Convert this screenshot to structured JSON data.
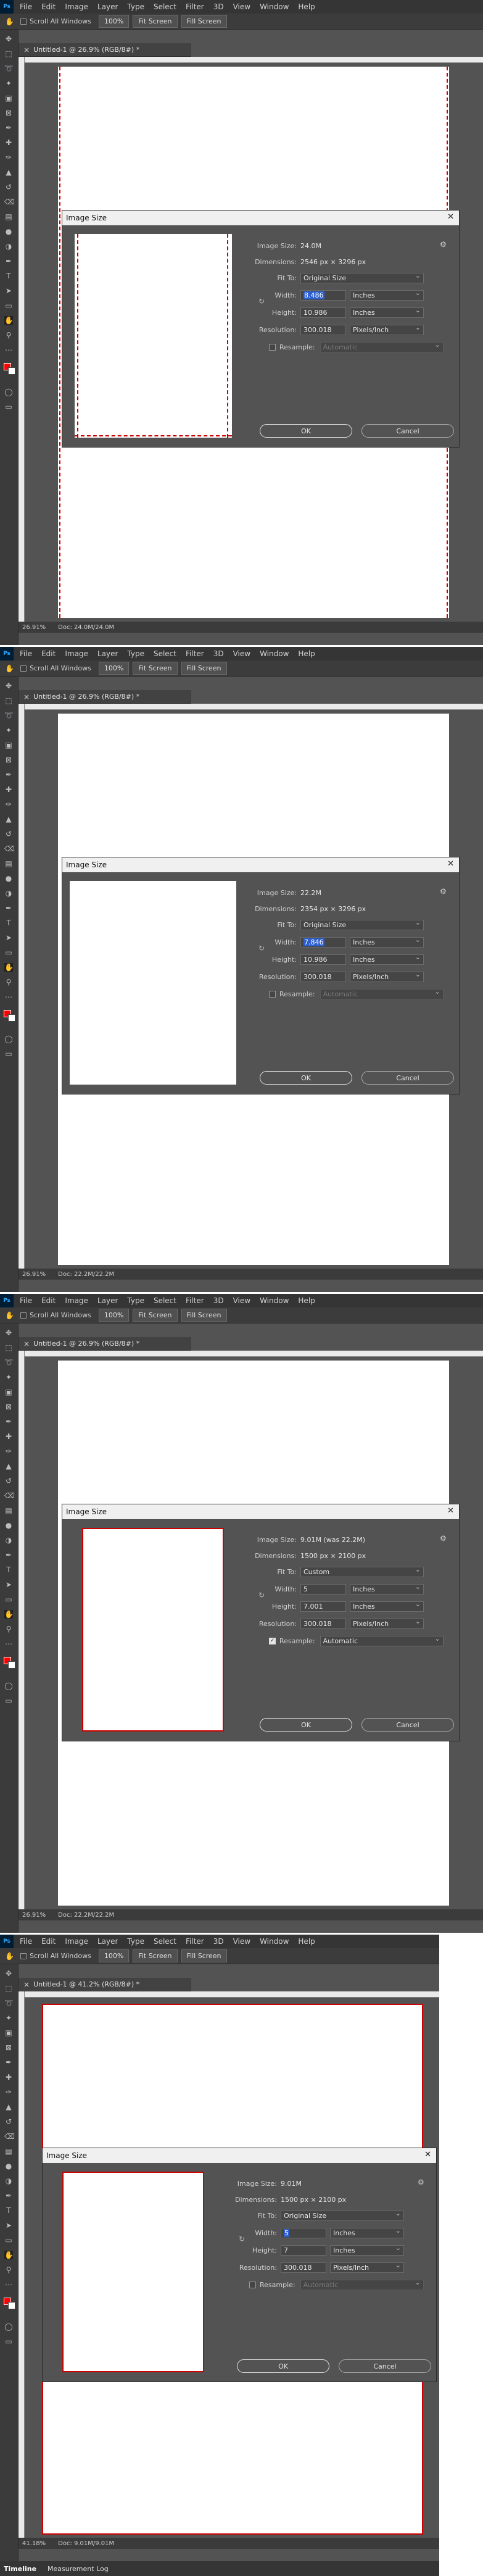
{
  "menu": {
    "logo": "Ps",
    "items": [
      "File",
      "Edit",
      "Image",
      "Layer",
      "Type",
      "Select",
      "Filter",
      "3D",
      "View",
      "Window",
      "Help"
    ]
  },
  "options": {
    "scroll_all_windows": "Scroll All Windows",
    "zoom_label": "100%",
    "fit_screen": "Fit Screen",
    "fill_screen": "Fill Screen"
  },
  "dialog_common": {
    "title": "Image Size",
    "image_size_label": "Image Size:",
    "dimensions_label": "Dimensions:",
    "fit_to_label": "Fit To:",
    "width_label": "Width:",
    "height_label": "Height:",
    "resolution_label": "Resolution:",
    "resample_label": "Resample:",
    "ok": "OK",
    "cancel": "Cancel",
    "units_inches": "Inches",
    "units_ppi": "Pixels/Inch"
  },
  "shots": [
    {
      "doc_tab": "Untitled-1 @ 26.9% (RGB/8#) *",
      "image_size": "24.0M",
      "dimensions": "2546 px  ×  3296 px",
      "fit_to": "Original Size",
      "width": "8.486",
      "height": "10.986",
      "resolution": "300.018",
      "resample_checked": false,
      "resample_value": "Automatic",
      "status_zoom": "26.91%",
      "status_doc": "Doc: 24.0M/24.0M"
    },
    {
      "doc_tab": "Untitled-1 @ 26.9% (RGB/8#) *",
      "image_size": "22.2M",
      "dimensions": "2354 px  ×  3296 px",
      "fit_to": "Original Size",
      "width": "7.846",
      "height": "10.986",
      "resolution": "300.018",
      "resample_checked": false,
      "resample_value": "Automatic",
      "status_zoom": "26.91%",
      "status_doc": "Doc: 22.2M/22.2M"
    },
    {
      "doc_tab": "Untitled-1 @ 26.9% (RGB/8#) *",
      "image_size": "9.01M (was 22.2M)",
      "dimensions": "1500 px  ×  2100 px",
      "fit_to": "Custom",
      "width": "5",
      "height": "7.001",
      "resolution": "300.018",
      "resample_checked": true,
      "resample_value": "Automatic",
      "status_zoom": "26.91%",
      "status_doc": "Doc: 22.2M/22.2M"
    },
    {
      "doc_tab": "Untitled-1 @ 41.2% (RGB/8#) *",
      "image_size": "9.01M",
      "dimensions": "1500 px  ×  2100 px",
      "fit_to": "Original Size",
      "width": "5",
      "height": "7",
      "resolution": "300.018",
      "resample_checked": false,
      "resample_value": "Automatic",
      "status_zoom": "41.18%",
      "status_doc": "Doc: 9.01M/9.01M"
    }
  ],
  "bottom_panel": {
    "tabs": [
      "Timeline",
      "Measurement Log"
    ]
  }
}
